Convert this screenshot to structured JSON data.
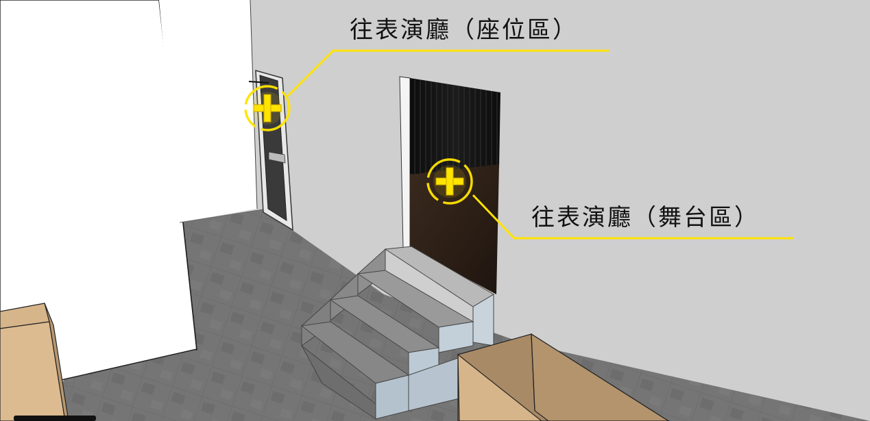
{
  "scene": {
    "marker_color": "#ffe400",
    "wall_color": "#cfcfcf",
    "floor_color": "#6b6b6b",
    "box_color": "#dcb88c",
    "stage_floor_color": "#2a1d15",
    "curtain_color": "#161616",
    "stair_color": "#a8b5c0"
  },
  "hotspots": [
    {
      "label": "往表演廳（座位區）",
      "icon": "plus-circle-icon"
    },
    {
      "label": "往表演廳（舞台區）",
      "icon": "plus-circle-icon"
    }
  ]
}
